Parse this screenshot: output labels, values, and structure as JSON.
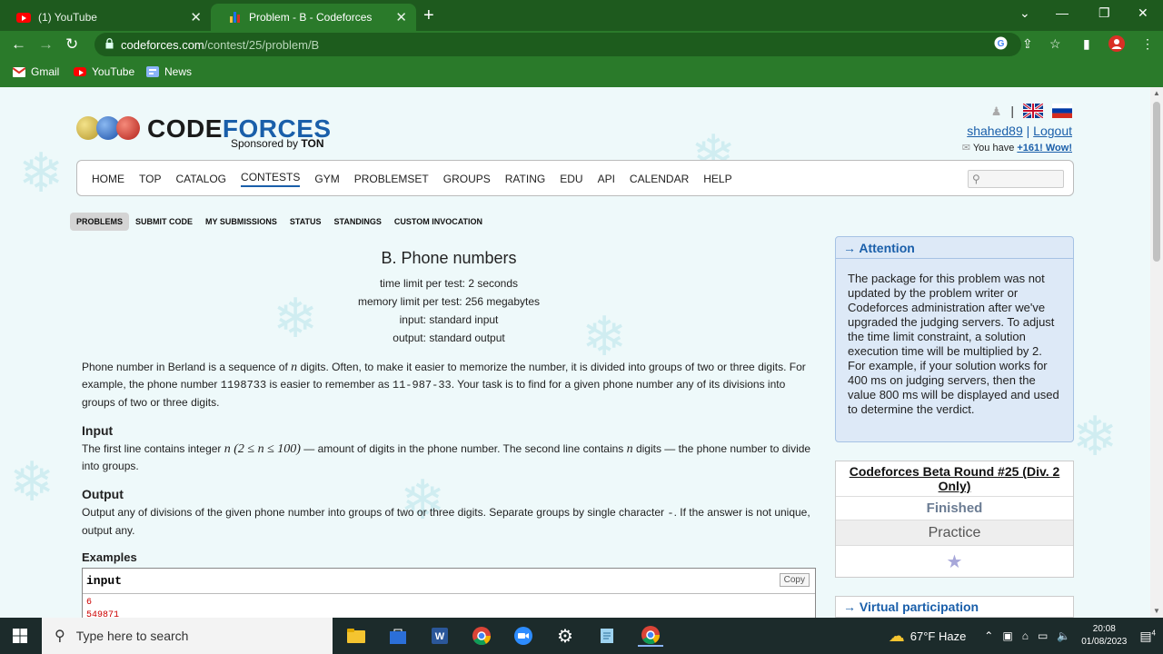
{
  "browser": {
    "tabs": [
      {
        "title": "(1) YouTube",
        "active": false,
        "icon": "youtube-icon"
      },
      {
        "title": "Problem - B - Codeforces",
        "active": true,
        "icon": "codeforces-icon"
      }
    ],
    "url_host": "codeforces.com",
    "url_path": "/contest/25/problem/B",
    "bookmarks": [
      {
        "label": "Gmail",
        "icon": "gmail-icon"
      },
      {
        "label": "YouTube",
        "icon": "youtube-icon"
      },
      {
        "label": "News",
        "icon": "news-icon"
      }
    ]
  },
  "header": {
    "logo_code": "CODE",
    "logo_forces": "FORCES",
    "sponsor_prefix": "Sponsored by ",
    "sponsor_name": "TON",
    "username": "shahed89",
    "separator": "|",
    "logout": "Logout",
    "notice_prefix": "You have ",
    "notice_link": "+161! Wow!"
  },
  "main_menu": [
    "HOME",
    "TOP",
    "CATALOG",
    "CONTESTS",
    "GYM",
    "PROBLEMSET",
    "GROUPS",
    "RATING",
    "EDU",
    "API",
    "CALENDAR",
    "HELP"
  ],
  "main_menu_active": "CONTESTS",
  "second_menu": [
    "PROBLEMS",
    "SUBMIT CODE",
    "MY SUBMISSIONS",
    "STATUS",
    "STANDINGS",
    "CUSTOM INVOCATION"
  ],
  "second_menu_active": "PROBLEMS",
  "problem": {
    "title": "B. Phone numbers",
    "time_limit": "time limit per test: 2 seconds",
    "memory_limit": "memory limit per test: 256 megabytes",
    "input_file": "input: standard input",
    "output_file": "output: standard output",
    "statement_1": "Phone number in Berland is a sequence of ",
    "var_n": "n",
    "statement_2": " digits. Often, to make it easier to memorize the number, it is divided into groups of two or three digits. For example, the phone number ",
    "example_number": "1198733",
    "statement_3": " is easier to remember as ",
    "example_split": "11-987-33",
    "statement_4": ". Your task is to find for a given phone number any of its divisions into groups of two or three digits.",
    "input_title": "Input",
    "input_1": "The first line contains integer ",
    "input_math": "n (2 ≤ n ≤ 100)",
    "input_2": " — amount of digits in the phone number. The second line contains ",
    "input_3": " digits — the phone number to divide into groups.",
    "output_title": "Output",
    "output_1": "Output any of divisions of the given phone number into groups of two or three digits. Separate groups by single character ",
    "output_dash": "-",
    "output_2": ". If the answer is not unique, output any.",
    "examples_title": "Examples",
    "sample_input_label": "input",
    "copy_label": "Copy",
    "sample_line_1": "6",
    "sample_line_2": "549871"
  },
  "sidebar": {
    "attention_title": "→ Attention",
    "attention_text": "The package for this problem was not updated by the problem writer or Codeforces administration after we've upgraded the judging servers. To adjust the time limit constraint, a solution execution time will be multiplied by 2. For example, if your solution works for 400 ms on judging servers, then the value 800 ms will be displayed and used to determine the verdict.",
    "contest_name": "Codeforces Beta Round #25 (Div. 2 Only)",
    "contest_status": "Finished",
    "contest_mode": "Practice",
    "virtual_title": "→ Virtual participation"
  },
  "taskbar": {
    "search_placeholder": "Type here to search",
    "weather": "67°F  Haze",
    "time": "20:08",
    "date": "01/08/2023",
    "notifications": "4"
  },
  "colors": {
    "chrome_dark": "#1e5a1e",
    "chrome": "#2a7a2a",
    "link": "#1a5faa",
    "page_bg": "#eef9fa"
  }
}
